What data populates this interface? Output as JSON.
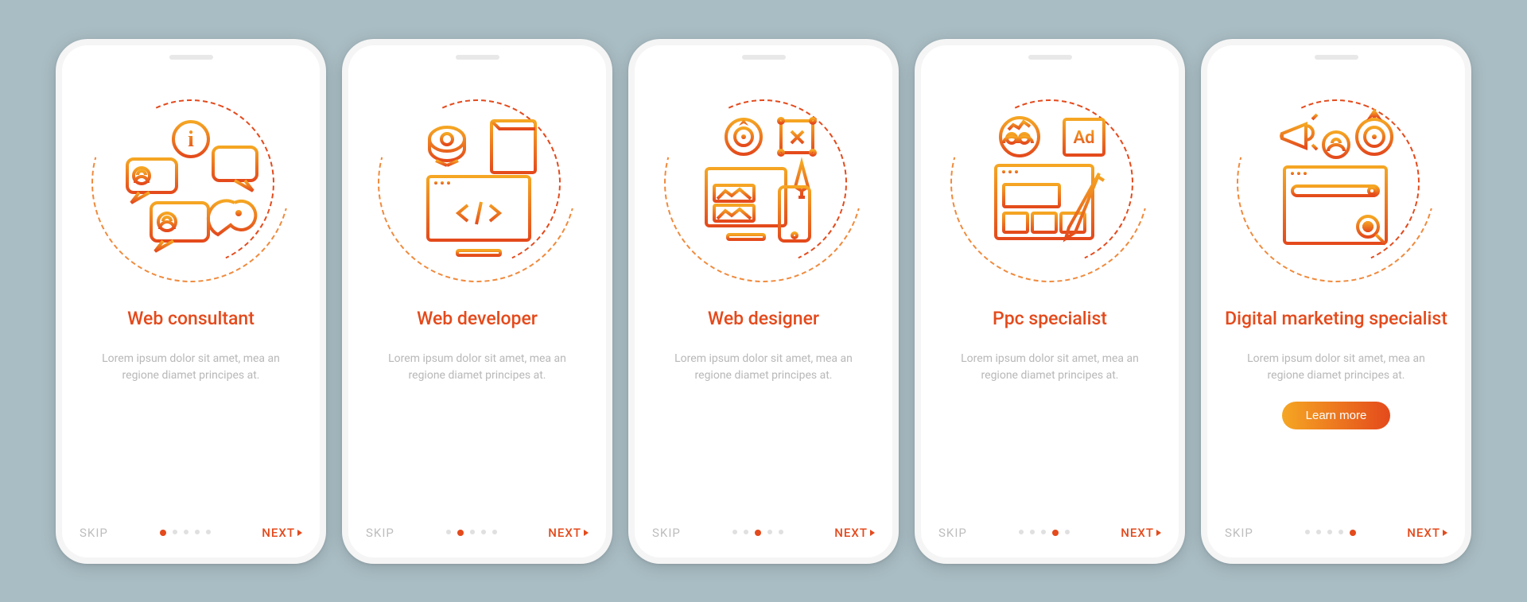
{
  "shared": {
    "skip_label": "SKIP",
    "next_label": "NEXT",
    "description": "Lorem ipsum dolor sit amet, mea an regione diamet principes at.",
    "learn_more": "Learn more",
    "dot_count": 5
  },
  "screens": [
    {
      "title": "Web consultant",
      "active_dot": 0,
      "show_cta": false,
      "icon": "consultant"
    },
    {
      "title": "Web developer",
      "active_dot": 1,
      "show_cta": false,
      "icon": "developer"
    },
    {
      "title": "Web designer",
      "active_dot": 2,
      "show_cta": false,
      "icon": "designer"
    },
    {
      "title": "Ppc specialist",
      "active_dot": 3,
      "show_cta": false,
      "icon": "ppc"
    },
    {
      "title": "Digital marketing specialist",
      "active_dot": 4,
      "show_cta": true,
      "icon": "marketing"
    }
  ]
}
